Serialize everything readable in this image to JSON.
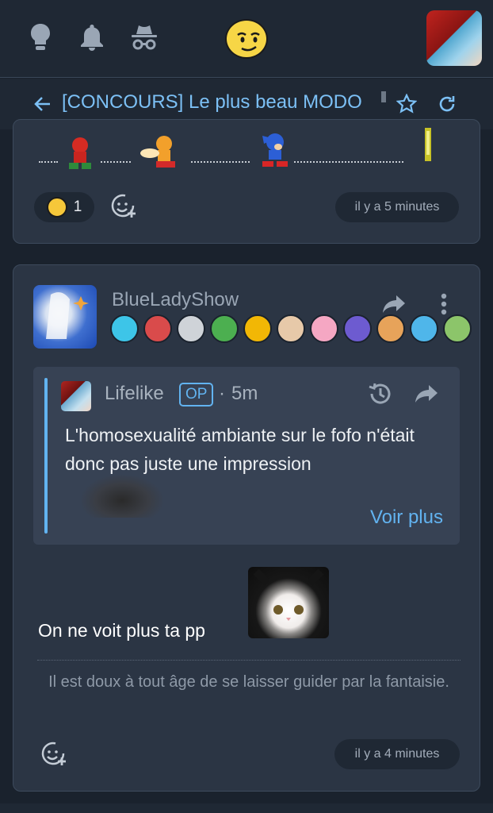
{
  "topbar": {
    "icons": [
      "lightbulb-icon",
      "bell-icon",
      "incognito-icon"
    ],
    "mood_icon": "smirking-face-icon"
  },
  "header": {
    "title": "[CONCOURS] Le plus beau MODO",
    "back_icon": "arrow-left-icon",
    "star_icon": "star-outline-icon",
    "refresh_icon": "refresh-icon"
  },
  "post1": {
    "reaction": {
      "icon": "laughing-tears-emoji",
      "count": "1"
    },
    "add_reaction_icon": "add-reaction-icon",
    "time": "il y a 5 minutes"
  },
  "post2": {
    "author": "BlueLadyShow",
    "badges_colors": [
      "#3dc5e8",
      "#d94b4b",
      "#cfd3d8",
      "#4caf50",
      "#f2b705",
      "#e7c9a9",
      "#f5a7c3",
      "#6d5bd0",
      "#e7a35a",
      "#4fb6ea",
      "#8cc56a"
    ],
    "quote": {
      "author": "Lifelike",
      "op_label": "OP",
      "separator": "·",
      "time": "5m",
      "text": "L'homosexualité ambiante sur le fofo n'était donc pas juste une impression",
      "more_label": "Voir plus"
    },
    "body": "On ne voit plus ta pp",
    "signature": "Il est doux à tout âge de se laisser guider par la fantaisie.",
    "add_reaction_icon": "add-reaction-icon",
    "time": "il y a 4 minutes"
  }
}
